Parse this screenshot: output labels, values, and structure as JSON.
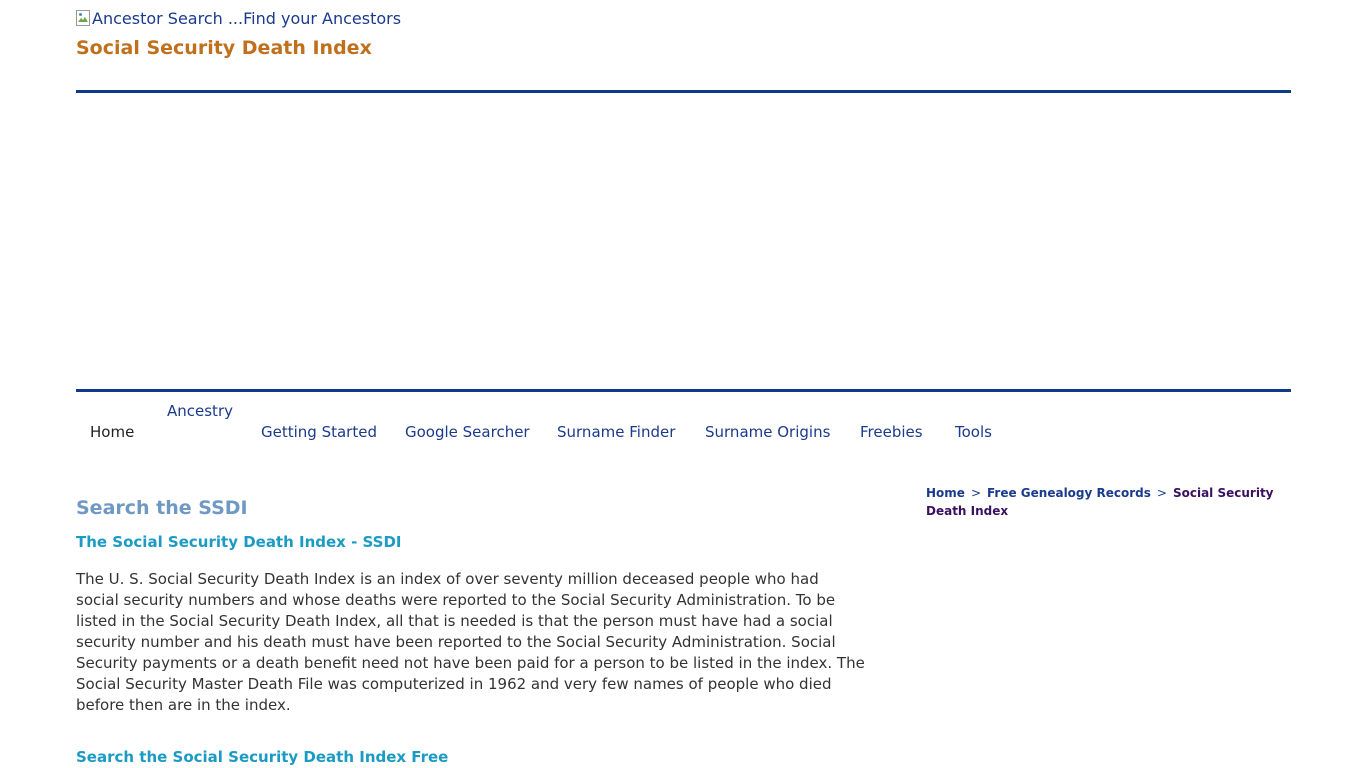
{
  "header": {
    "logo_alt": "Ancestor Search ...Find your Ancestors",
    "site_title": "Social Security Death Index"
  },
  "nav": {
    "items": [
      {
        "label": "Home"
      },
      {
        "label": "Ancestry"
      },
      {
        "label": "Getting Started"
      },
      {
        "label": "Google Searcher"
      },
      {
        "label": "Surname Finder"
      },
      {
        "label": "Surname Origins"
      },
      {
        "label": "Freebies"
      },
      {
        "label": "Tools"
      }
    ]
  },
  "breadcrumb": {
    "home": "Home",
    "separator": ">",
    "records": "Free Genealogy Records",
    "current": "Social Security Death Index"
  },
  "main": {
    "heading": "Search the SSDI",
    "subheading": "The Social Security Death Index - SSDI",
    "paragraph": "The U. S. Social Security Death Index is an index of over seventy million deceased people who had social security numbers and whose deaths were reported to the Social Security Administration. To be listed in the Social Security Death Index, all that is needed is that the person must have had a social security number and his death must have been reported to the Social Security Administration. Social Security payments or a death benefit need not have been paid for a person to be listed in the index. The Social Security Master Death File was computerized in 1962 and very few names of people who died before then are in the index.",
    "subheading2": "Search the Social Security Death Index Free"
  },
  "colors": {
    "rule": "#0f3a85",
    "site_title": "#c0701c",
    "heading": "#6f99c4",
    "subheading": "#1b9bc4",
    "link": "#1a3a8c"
  }
}
